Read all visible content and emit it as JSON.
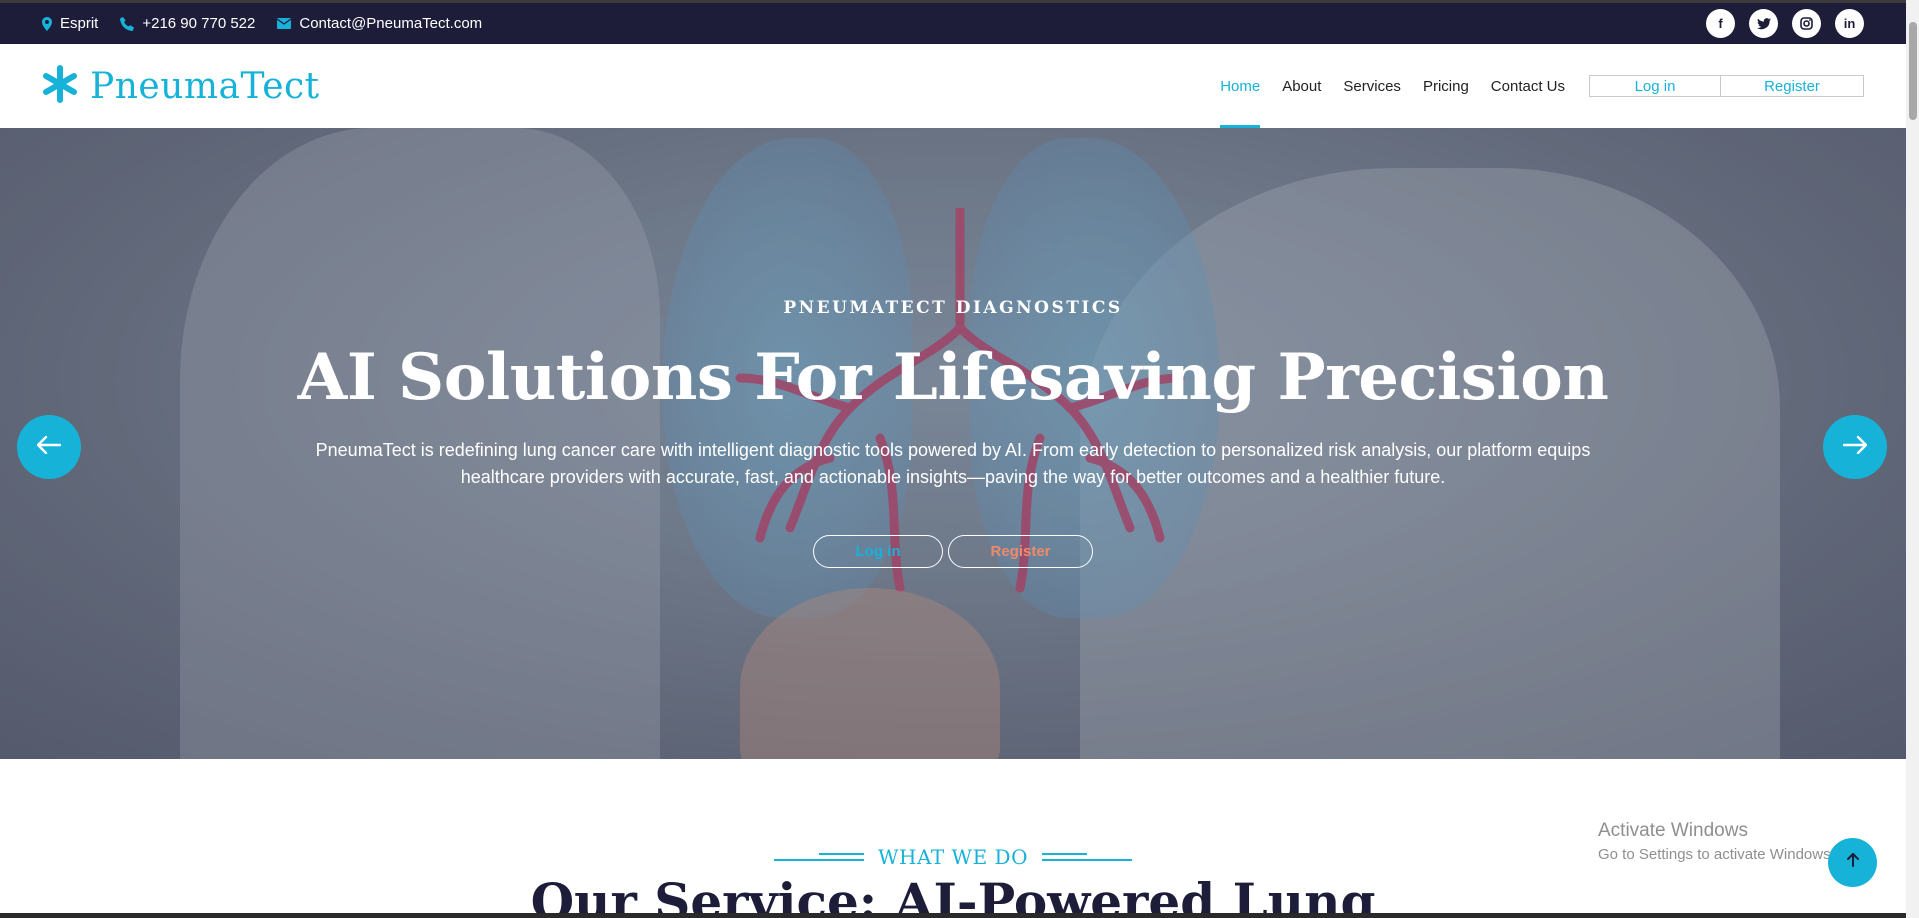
{
  "topbar": {
    "location": "Esprit",
    "phone": "+216 90 770 522",
    "email": "Contact@PneumaTect.com",
    "socials": [
      {
        "icon": "facebook-icon",
        "glyph": "f"
      },
      {
        "icon": "twitter-icon",
        "glyph": "t"
      },
      {
        "icon": "instagram-icon",
        "glyph": "◎"
      },
      {
        "icon": "linkedin-icon",
        "glyph": "in"
      }
    ]
  },
  "brand": {
    "name": "PneumaTect",
    "icon": "asterisk-icon",
    "color": "#17b2d8"
  },
  "nav": {
    "items": [
      {
        "label": "Home",
        "active": true
      },
      {
        "label": "About"
      },
      {
        "label": "Services"
      },
      {
        "label": "Pricing"
      },
      {
        "label": "Contact Us"
      }
    ],
    "login_label": "Log in",
    "register_label": "Register"
  },
  "hero": {
    "kicker": "PNEUMATECT DIAGNOSTICS",
    "title": "AI Solutions For Lifesaving Precision",
    "description": "PneumaTect is redefining lung cancer care with intelligent diagnostic tools powered by AI. From early detection to personalized risk analysis, our platform equips healthcare providers with accurate, fast, and actionable insights—paving the way for better outcomes and a healthier future.",
    "login_label": "Log in",
    "register_label": "Register"
  },
  "section": {
    "kicker": "WHAT WE DO",
    "title": "Our Service: AI-Powered Lung"
  },
  "watermark": {
    "line1": "Activate Windows",
    "line2": "Go to Settings to activate Windows."
  },
  "colors": {
    "accent": "#17b2d8",
    "dark": "#1d1d3a",
    "register": "#f08a6a"
  }
}
